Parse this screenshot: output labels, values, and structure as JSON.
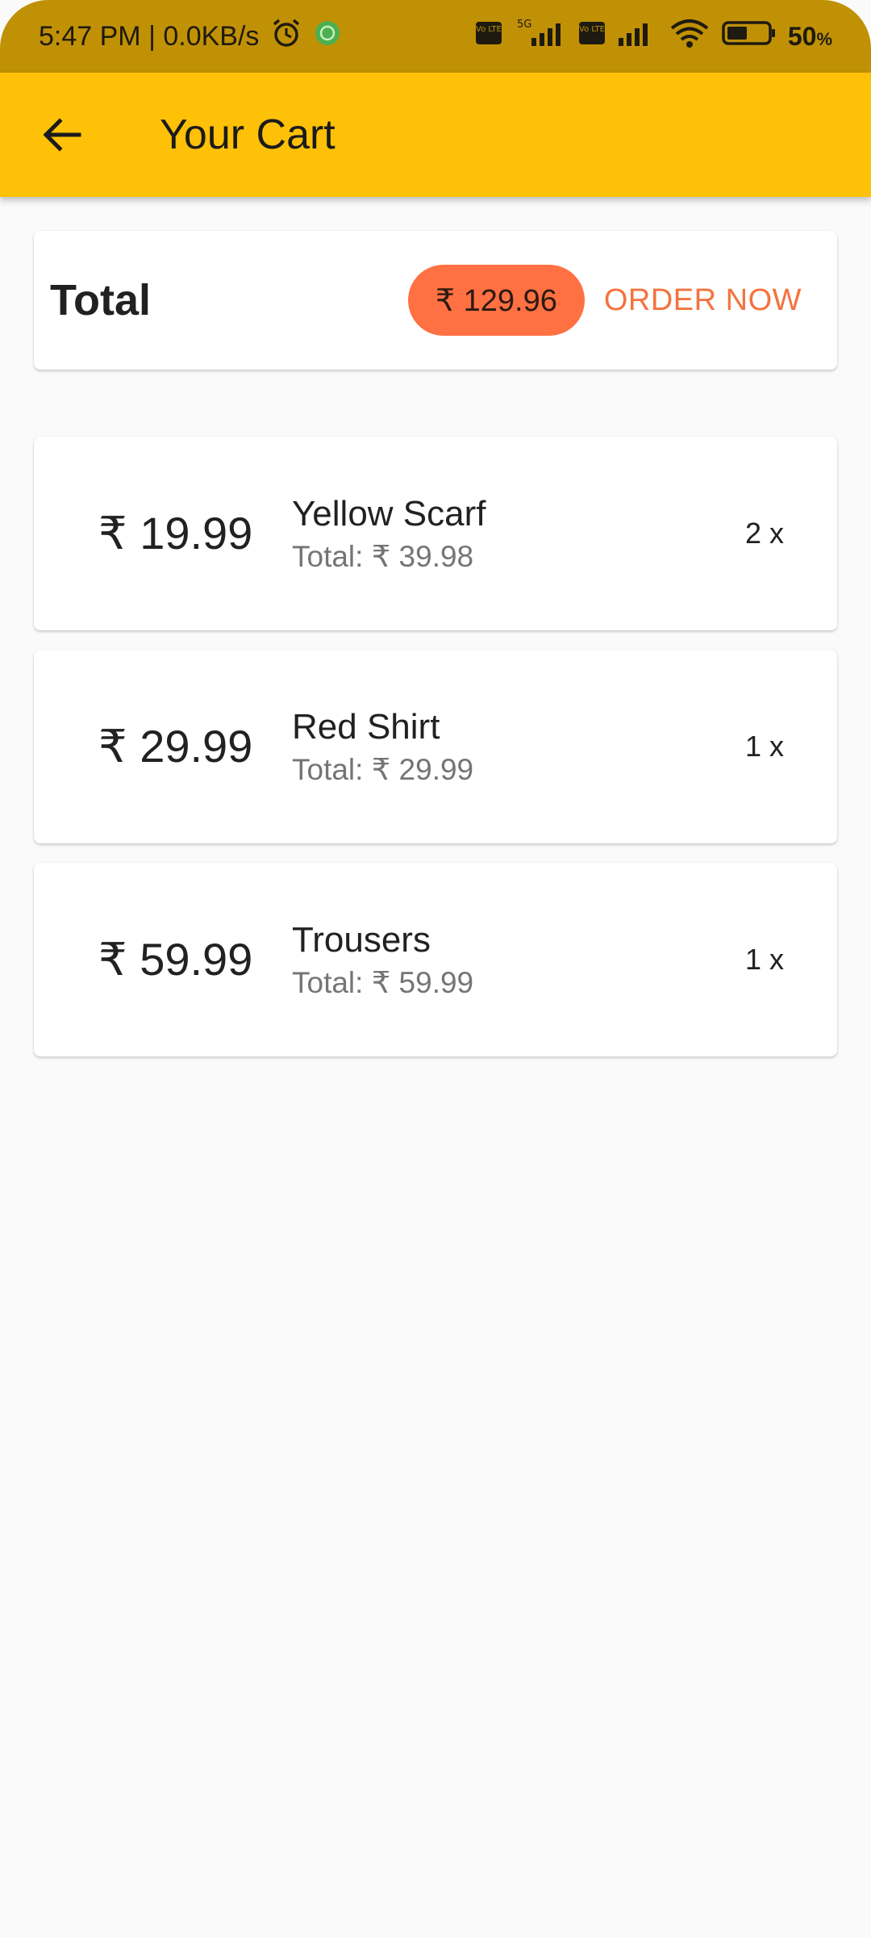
{
  "status_bar": {
    "time_network": "5:47 PM | 0.0KB/s",
    "sim1_label": "Vo LTE",
    "network_5g": "5G",
    "sim2_label": "Vo LTE",
    "battery_percent": "50",
    "battery_unit": "%",
    "battery_level": 0.5
  },
  "app_bar": {
    "title": "Your Cart",
    "back_icon": "arrow-back-icon"
  },
  "summary": {
    "total_label": "Total",
    "total_amount": "₹ 129.96",
    "order_button": "ORDER NOW"
  },
  "cart": {
    "items": [
      {
        "price": "₹ 19.99",
        "name": "Yellow Scarf",
        "total": "Total: ₹ 39.98",
        "quantity": "2 x"
      },
      {
        "price": "₹ 29.99",
        "name": "Red Shirt",
        "total": "Total: ₹ 29.99",
        "quantity": "1 x"
      },
      {
        "price": "₹ 59.99",
        "name": "Trousers",
        "total": "Total: ₹ 59.99",
        "quantity": "1 x"
      }
    ]
  },
  "colors": {
    "status_bar": "#c19105",
    "app_bar": "#ffc107",
    "accent": "#ff7043",
    "background": "#fafafa"
  }
}
